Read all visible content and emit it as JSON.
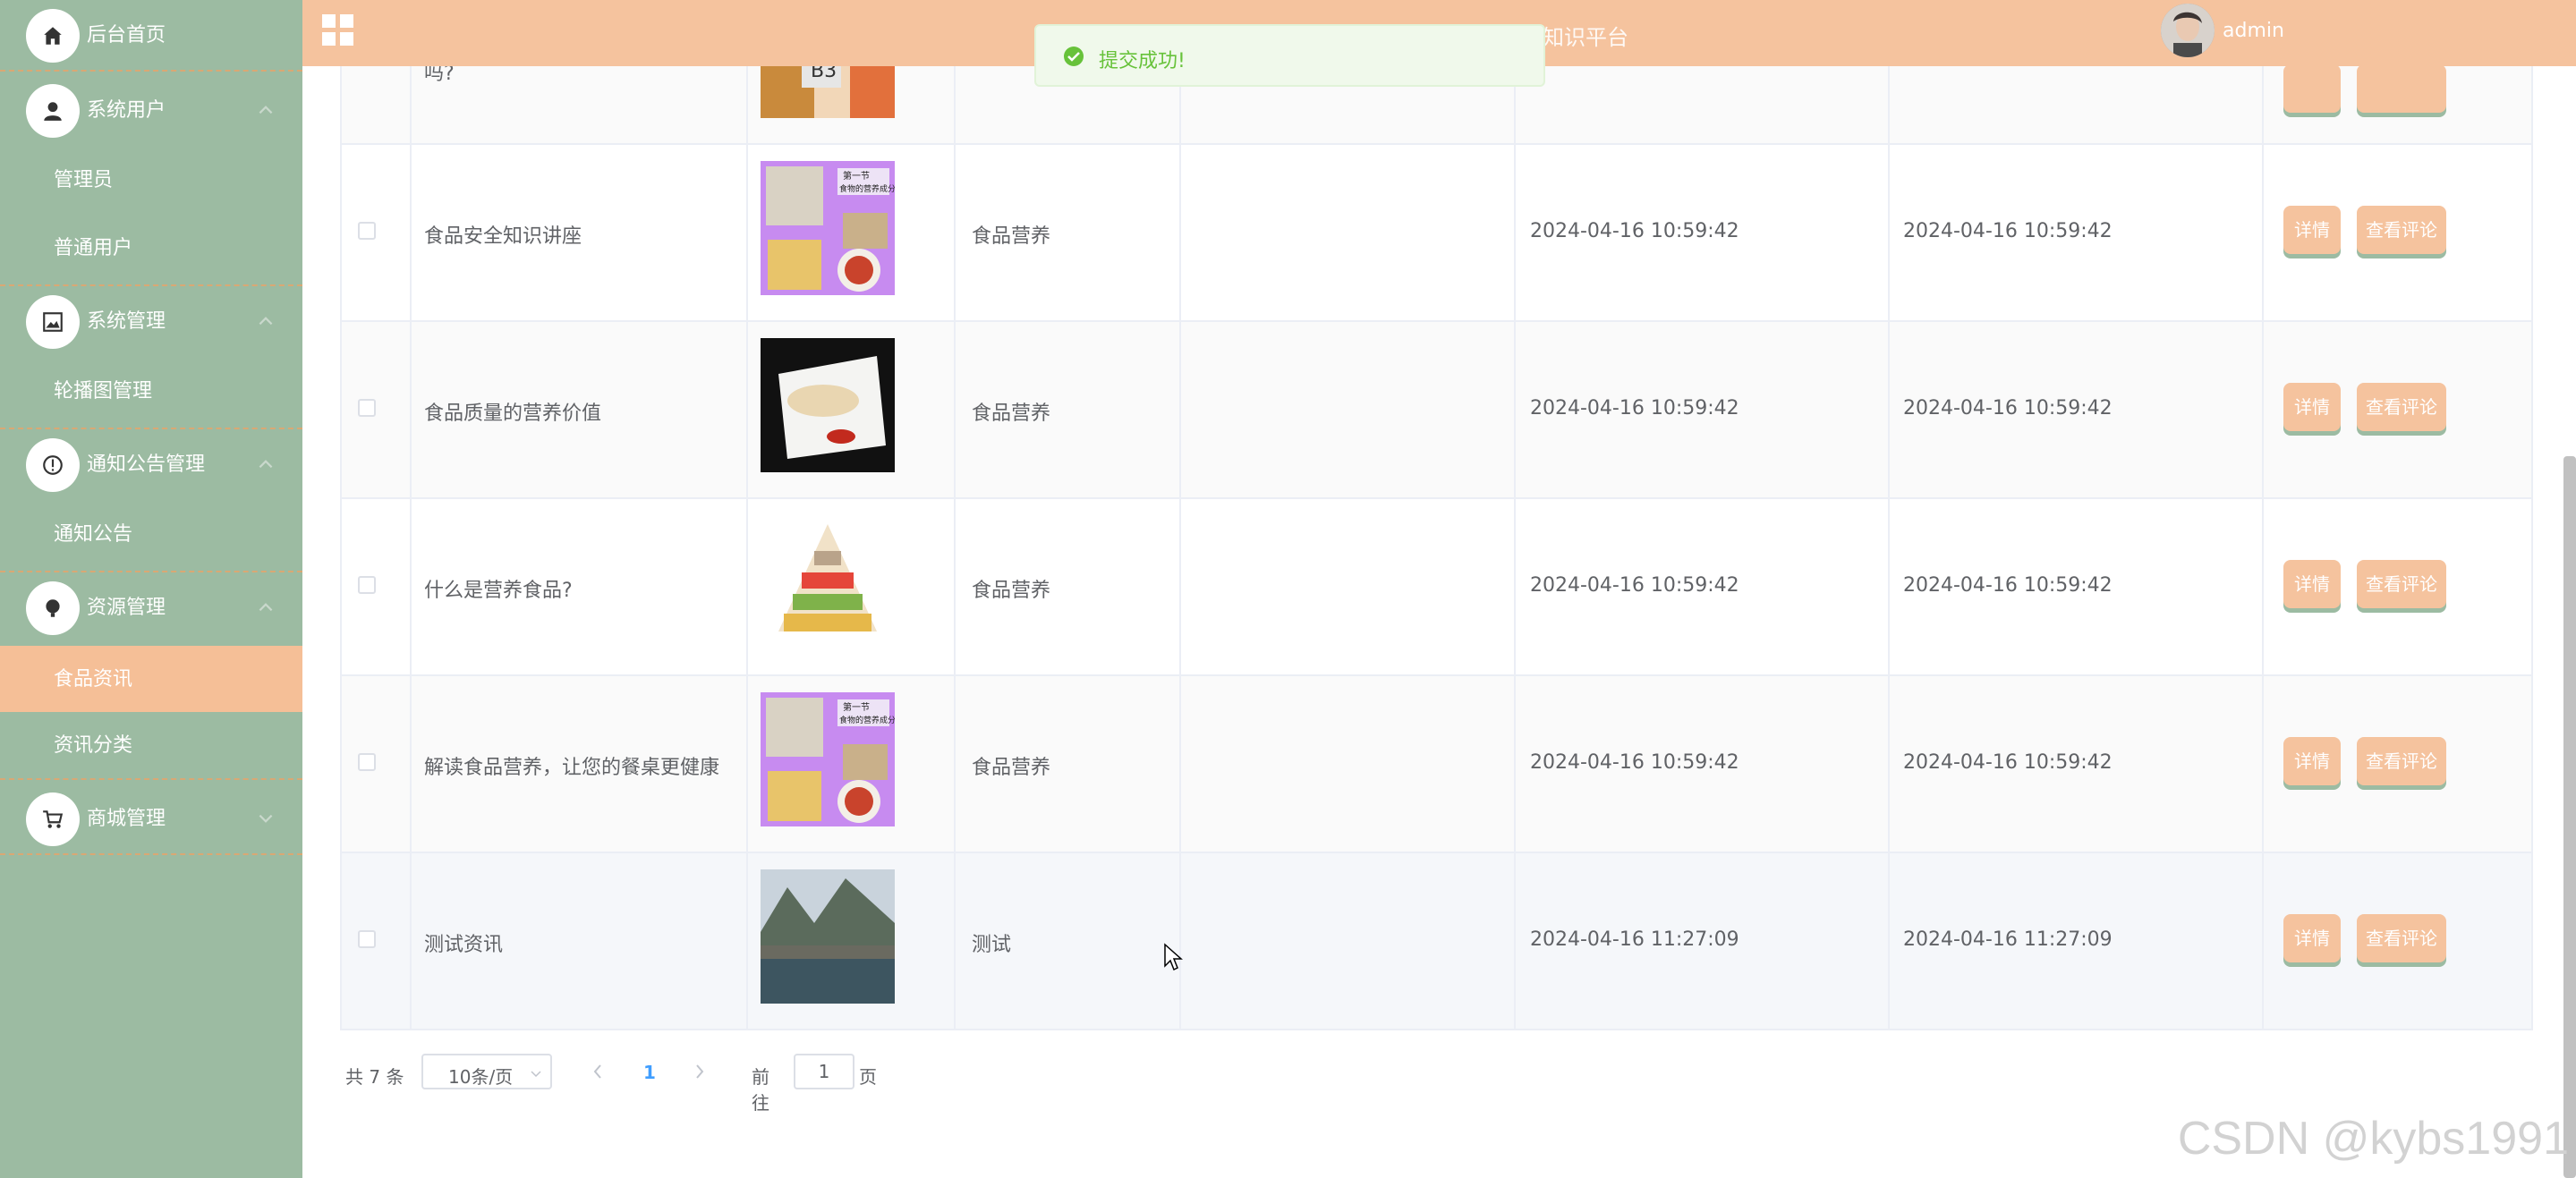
{
  "sidebar": {
    "items": [
      {
        "label": "后台首页",
        "type": "top",
        "icon": "home-icon"
      },
      {
        "label": "系统用户",
        "type": "top",
        "icon": "user-icon"
      },
      {
        "label": "管理员",
        "type": "sub"
      },
      {
        "label": "普通用户",
        "type": "sub"
      },
      {
        "label": "系统管理",
        "type": "top",
        "icon": "image-icon"
      },
      {
        "label": "轮播图管理",
        "type": "sub"
      },
      {
        "label": "通知公告管理",
        "type": "top",
        "icon": "info-icon"
      },
      {
        "label": "通知公告",
        "type": "sub"
      },
      {
        "label": "资源管理",
        "type": "top",
        "icon": "bulb-icon"
      },
      {
        "label": "食品资讯",
        "type": "sub",
        "active": true
      },
      {
        "label": "资讯分类",
        "type": "sub"
      },
      {
        "label": "商城管理",
        "type": "top",
        "icon": "cart-icon"
      }
    ]
  },
  "topbar": {
    "title": "基于SSM+Vue的营养知识平台",
    "username": "admin"
  },
  "toast": {
    "message": "提交成功!"
  },
  "table": {
    "partial_title": "吗?",
    "rows": [
      {
        "title": "食品安全知识讲座",
        "image": "purple-nutrition-banner",
        "category": "食品营养",
        "created": "2024-04-16 10:59:42",
        "updated": "2024-04-16 10:59:42"
      },
      {
        "title": "食品质量的营养价值",
        "image": "dumplings-plate",
        "category": "食品营养",
        "created": "2024-04-16 10:59:42",
        "updated": "2024-04-16 10:59:42"
      },
      {
        "title": "什么是营养食品?",
        "image": "food-pyramid",
        "category": "食品营养",
        "created": "2024-04-16 10:59:42",
        "updated": "2024-04-16 10:59:42"
      },
      {
        "title": "解读食品营养，让您的餐桌更健康",
        "image": "purple-nutrition-banner",
        "category": "食品营养",
        "created": "2024-04-16 10:59:42",
        "updated": "2024-04-16 10:59:42"
      },
      {
        "title": "测试资讯",
        "image": "river-town",
        "category": "测试",
        "created": "2024-04-16 11:27:09",
        "updated": "2024-04-16 11:27:09"
      }
    ],
    "detail_label": "详情",
    "comment_label": "查看评论"
  },
  "pagination": {
    "total": "共 7 条",
    "page_size": "10条/页",
    "current_page": "1",
    "goto_label": "前往",
    "goto_value": "1",
    "page_suffix": "页"
  },
  "watermark": "CSDN @kybs1991",
  "colors": {
    "sidebar": "#9cbba2",
    "topbar": "#f5c39e",
    "button": "#f5c39e",
    "active": "#f5bf97"
  }
}
